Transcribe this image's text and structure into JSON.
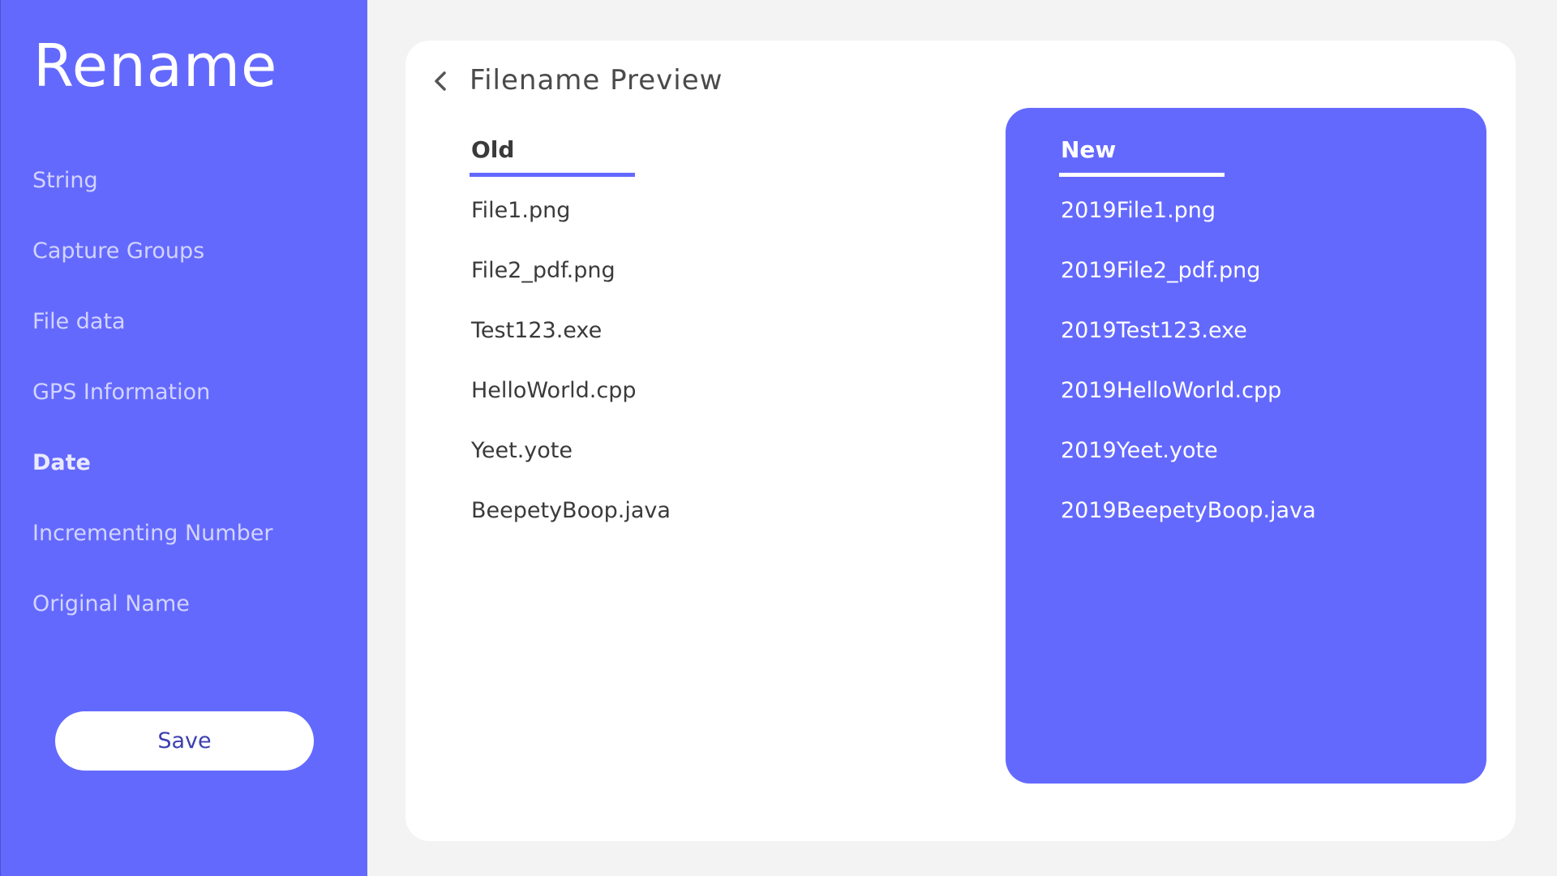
{
  "sidebar": {
    "title": "Rename",
    "items": [
      {
        "label": "String"
      },
      {
        "label": "Capture Groups"
      },
      {
        "label": "File data"
      },
      {
        "label": "GPS Information"
      },
      {
        "label": "Date",
        "active": true
      },
      {
        "label": "Incrementing Number"
      },
      {
        "label": "Original Name"
      }
    ],
    "save_label": "Save"
  },
  "preview": {
    "title": "Filename Preview",
    "back_icon": "chevron-left-icon",
    "old": {
      "header": "Old",
      "files": [
        "File1.png",
        "File2_pdf.png",
        "Test123.exe",
        "HelloWorld.cpp",
        "Yeet.yote",
        "BeepetyBoop.java"
      ]
    },
    "new": {
      "header": "New",
      "files": [
        "2019File1.png",
        "2019File2_pdf.png",
        "2019Test123.exe",
        "2019HelloWorld.cpp",
        "2019Yeet.yote",
        "2019BeepetyBoop.java"
      ]
    }
  },
  "colors": {
    "accent": "#6469fe",
    "background": "#f3f3f3",
    "card": "#ffffff"
  }
}
